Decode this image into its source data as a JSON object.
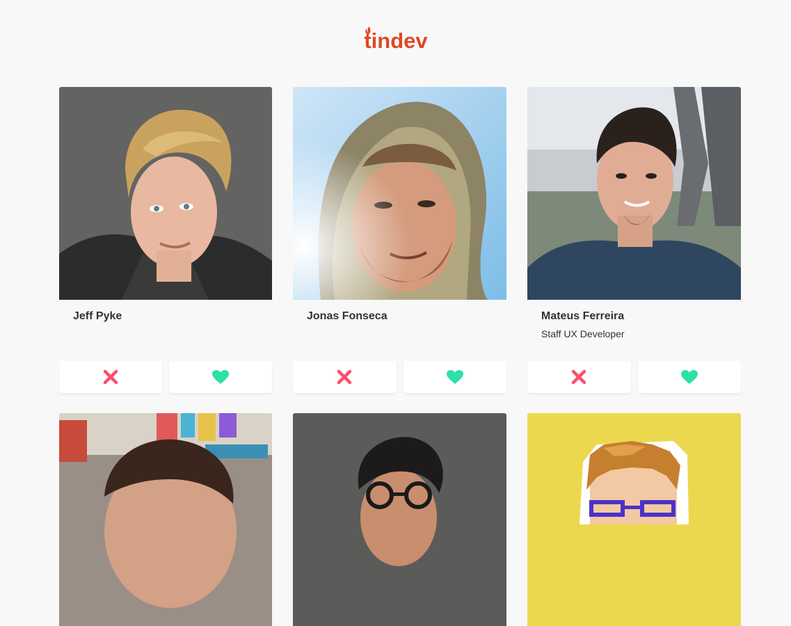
{
  "app": {
    "logo_text": "tindev",
    "brand_color": "#df4723"
  },
  "actions": {
    "dislike_icon": "close-icon",
    "like_icon": "heart-icon",
    "dislike_color": "#ff4d6b",
    "like_color": "#2de0a7"
  },
  "devs": [
    {
      "name": "Jeff Pyke",
      "bio": ""
    },
    {
      "name": "Jonas Fonseca",
      "bio": ""
    },
    {
      "name": "Mateus Ferreira",
      "bio": "Staff UX Developer"
    },
    {
      "name": "",
      "bio": ""
    },
    {
      "name": "",
      "bio": ""
    },
    {
      "name": "",
      "bio": ""
    }
  ]
}
